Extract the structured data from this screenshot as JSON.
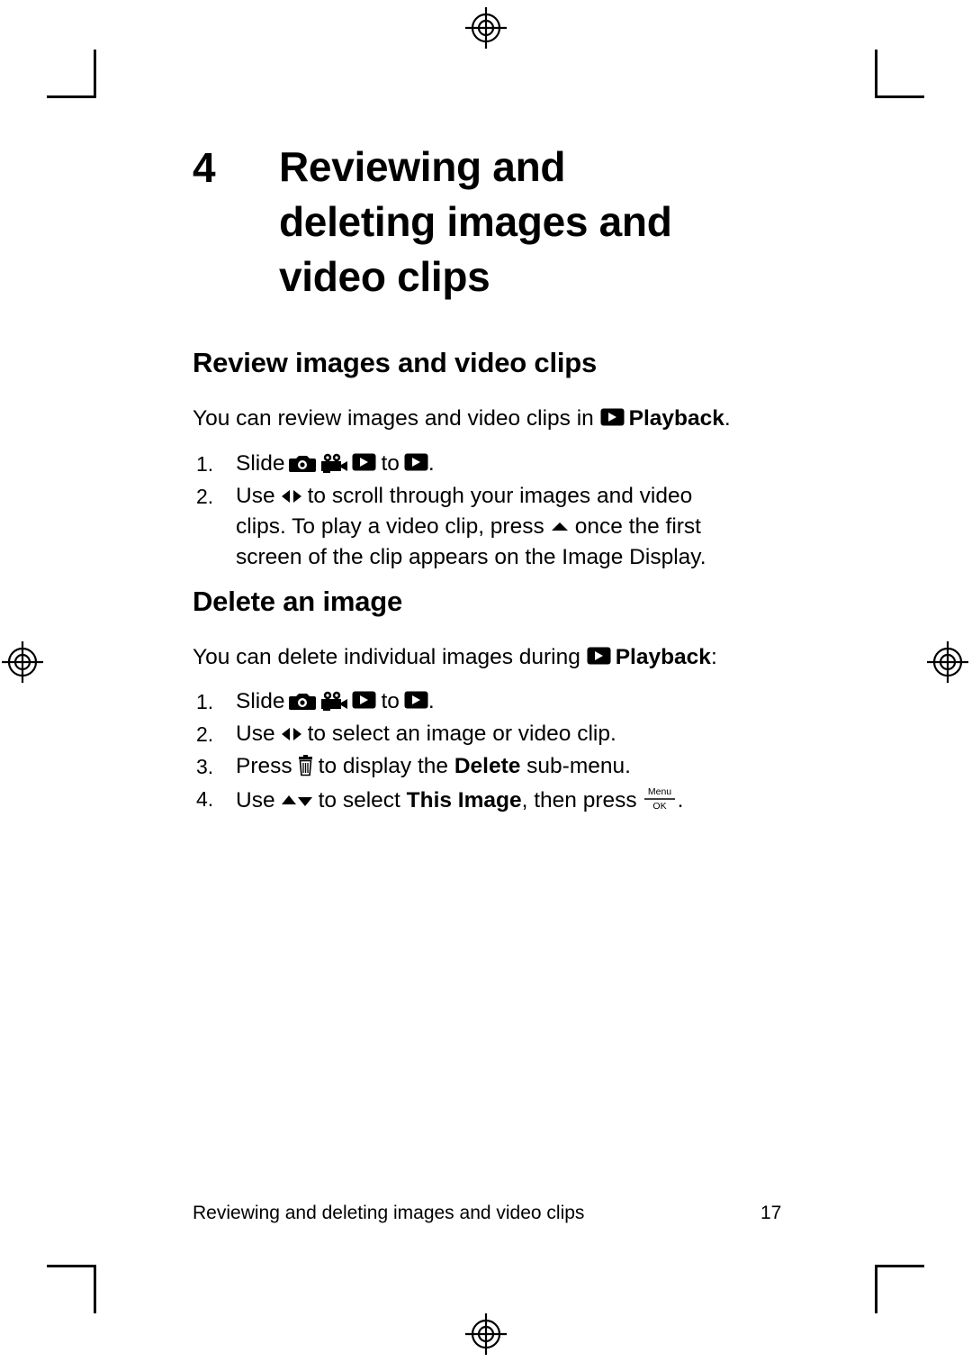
{
  "document": {
    "chapter_number": "4",
    "chapter_title_lines": [
      "Reviewing and",
      "deleting images and",
      "video clips"
    ],
    "sections": [
      {
        "id": "review",
        "heading": "Review images and video clips",
        "intro_before": "You can review images and video clips in ",
        "intro_bold": "Playback",
        "intro_after": ".",
        "steps": [
          {
            "num": "1.",
            "text_a": "Slide",
            "text_b": "to",
            "text_c": "."
          },
          {
            "num": "2.",
            "text_a": "Use",
            "text_b": "to scroll through your images and video",
            "line2_a": "clips. To play a video clip, press",
            "line2_b": "once the first",
            "line3": "screen of the clip appears on the Image Display."
          }
        ]
      },
      {
        "id": "delete",
        "heading": "Delete an image",
        "intro_before": "You can delete individual images during ",
        "intro_bold": "Playback",
        "intro_after": ":",
        "steps": [
          {
            "num": "1.",
            "text_a": "Slide",
            "text_b": "to",
            "text_c": "."
          },
          {
            "num": "2.",
            "text_a": "Use",
            "text_b": "to select an image or video clip."
          },
          {
            "num": "3.",
            "text_a": "Press",
            "text_b": "to display the ",
            "bold": "Delete",
            "text_c": " sub-menu."
          },
          {
            "num": "4.",
            "text_a": "Use",
            "text_b": "to select ",
            "bold": "This Image",
            "text_c": ", then press",
            "text_d": "."
          }
        ]
      }
    ],
    "footer": {
      "title": "Reviewing and deleting images and video clips",
      "page_number": "17"
    },
    "icons": {
      "playback": "playback-icon",
      "still_capture": "still-capture-icon",
      "video_capture": "video-capture-icon",
      "left_right": "left-right-arrows-icon",
      "up": "up-arrow-icon",
      "up_down": "up-down-arrows-icon",
      "delete": "trash-can-icon",
      "menu_ok": "menu-ok-button-icon",
      "menu_ok_top_label": "Menu",
      "menu_ok_bottom_label": "OK"
    }
  }
}
